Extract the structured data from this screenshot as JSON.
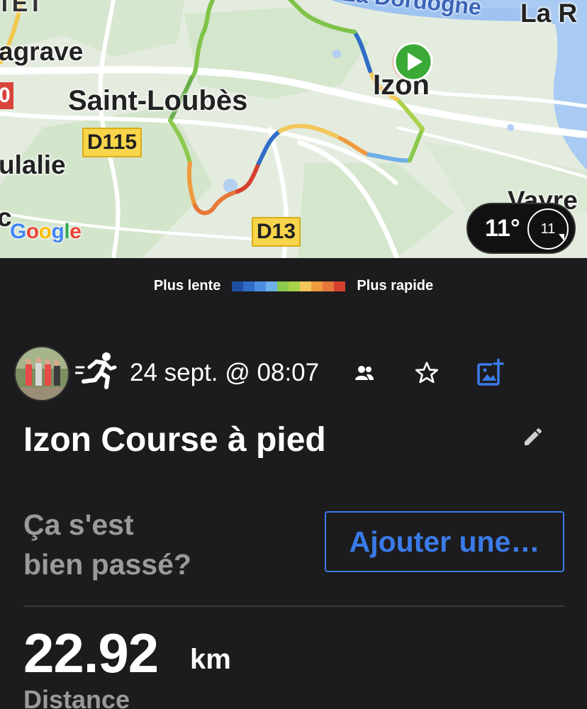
{
  "map": {
    "labels": {
      "top_left_fragment": "TET",
      "lagrave": "agrave",
      "saint_loubes": "Saint-Loubès",
      "eulalie": "ulalie",
      "c": "c",
      "izon": "Izon",
      "la_dordogne": "La Dordogne",
      "la_r": "La R",
      "vayres": "Vayre"
    },
    "roads": {
      "d115": "D115",
      "d13": "D13",
      "red_badge": "0"
    },
    "google": [
      "G",
      "o",
      "o",
      "g",
      "l",
      "e"
    ],
    "google_colors": [
      "#4285F4",
      "#EA4335",
      "#FBBC05",
      "#4285F4",
      "#34A853",
      "#EA4335"
    ],
    "weather": {
      "temp": "11°",
      "wind": "11"
    }
  },
  "legend": {
    "slow": "Plus lente",
    "fast": "Plus rapide",
    "colors": [
      "#1f4fa3",
      "#2f6cc7",
      "#4b8de0",
      "#6eb0e8",
      "#8cc94d",
      "#a9d14a",
      "#f2c65a",
      "#ef9a3e",
      "#e6773a",
      "#d6412f"
    ]
  },
  "activity": {
    "date": "24 sept. @ 08:07",
    "title": "Izon Course à pied",
    "question": "Ça s'est\nbien passé?",
    "question_line1": "Ça s'est",
    "question_line2": "bien passé?",
    "add_button": "Ajouter une…",
    "distance_value": "22.92",
    "distance_unit": "km",
    "distance_label": "Distance"
  },
  "icons": {
    "run": "run-icon",
    "group": "group-icon",
    "star": "star-icon",
    "add_photo": "add-photo-icon",
    "edit": "pencil-icon"
  }
}
